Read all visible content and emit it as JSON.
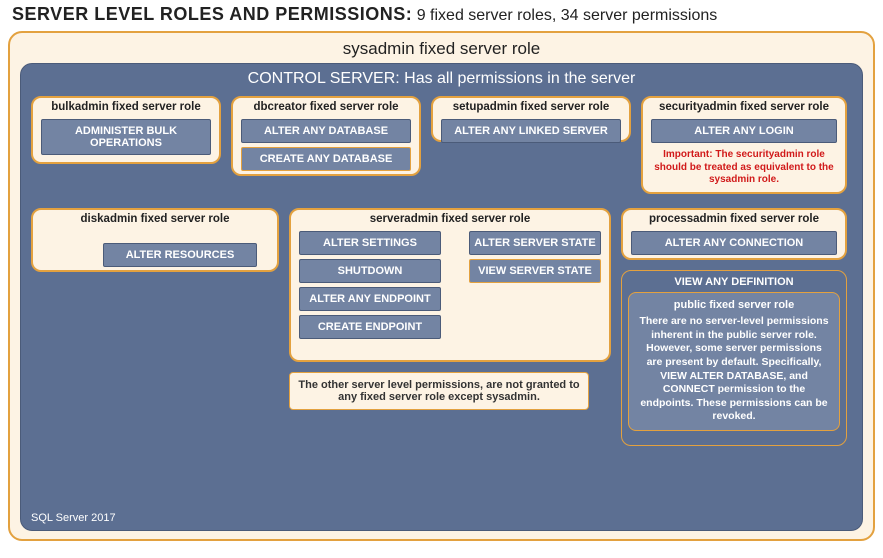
{
  "title_bold": "SERVER LEVEL ROLES AND PERMISSIONS:",
  "title_rest": " 9 fixed server roles, 34 server permissions",
  "sysadmin_label": "sysadmin fixed server role",
  "control_server_label": "CONTROL SERVER: Has all permissions in the server",
  "roles": {
    "bulkadmin": {
      "title": "bulkadmin fixed server role",
      "perms": [
        "ADMINISTER BULK OPERATIONS"
      ]
    },
    "dbcreator": {
      "title": "dbcreator fixed server role",
      "perms": [
        "ALTER ANY DATABASE",
        "CREATE ANY DATABASE"
      ]
    },
    "setupadmin": {
      "title": "setupadmin fixed server role",
      "perms": [
        "ALTER ANY LINKED SERVER"
      ]
    },
    "securityadmin": {
      "title": "securityadmin fixed server role",
      "perms": [
        "ALTER ANY LOGIN"
      ],
      "warn": "Important: The securityadmin role should be treated as equivalent to the sysadmin role."
    },
    "diskadmin": {
      "title": "diskadmin fixed server role",
      "perms": [
        "ALTER RESOURCES"
      ]
    },
    "serveradmin": {
      "title": "serveradmin fixed server role",
      "left": [
        "ALTER SETTINGS",
        "SHUTDOWN",
        "ALTER ANY ENDPOINT",
        "CREATE ENDPOINT"
      ],
      "right": [
        "ALTER SERVER STATE",
        "VIEW SERVER STATE"
      ]
    },
    "processadmin": {
      "title": "processadmin fixed server role",
      "perms": [
        "ALTER ANY CONNECTION"
      ]
    }
  },
  "other_note": "The other server level permissions, are not granted to any fixed server role except sysadmin.",
  "viewdef": {
    "title": "VIEW ANY DEFINITION",
    "public_title": "public fixed server role",
    "public_text": "There are no server-level permissions inherent in the public server role. However, some server permissions are present by default. Specifically, VIEW ALTER DATABASE, and CONNECT permission to the endpoints. These permissions can be revoked."
  },
  "version": "SQL Server 2017"
}
